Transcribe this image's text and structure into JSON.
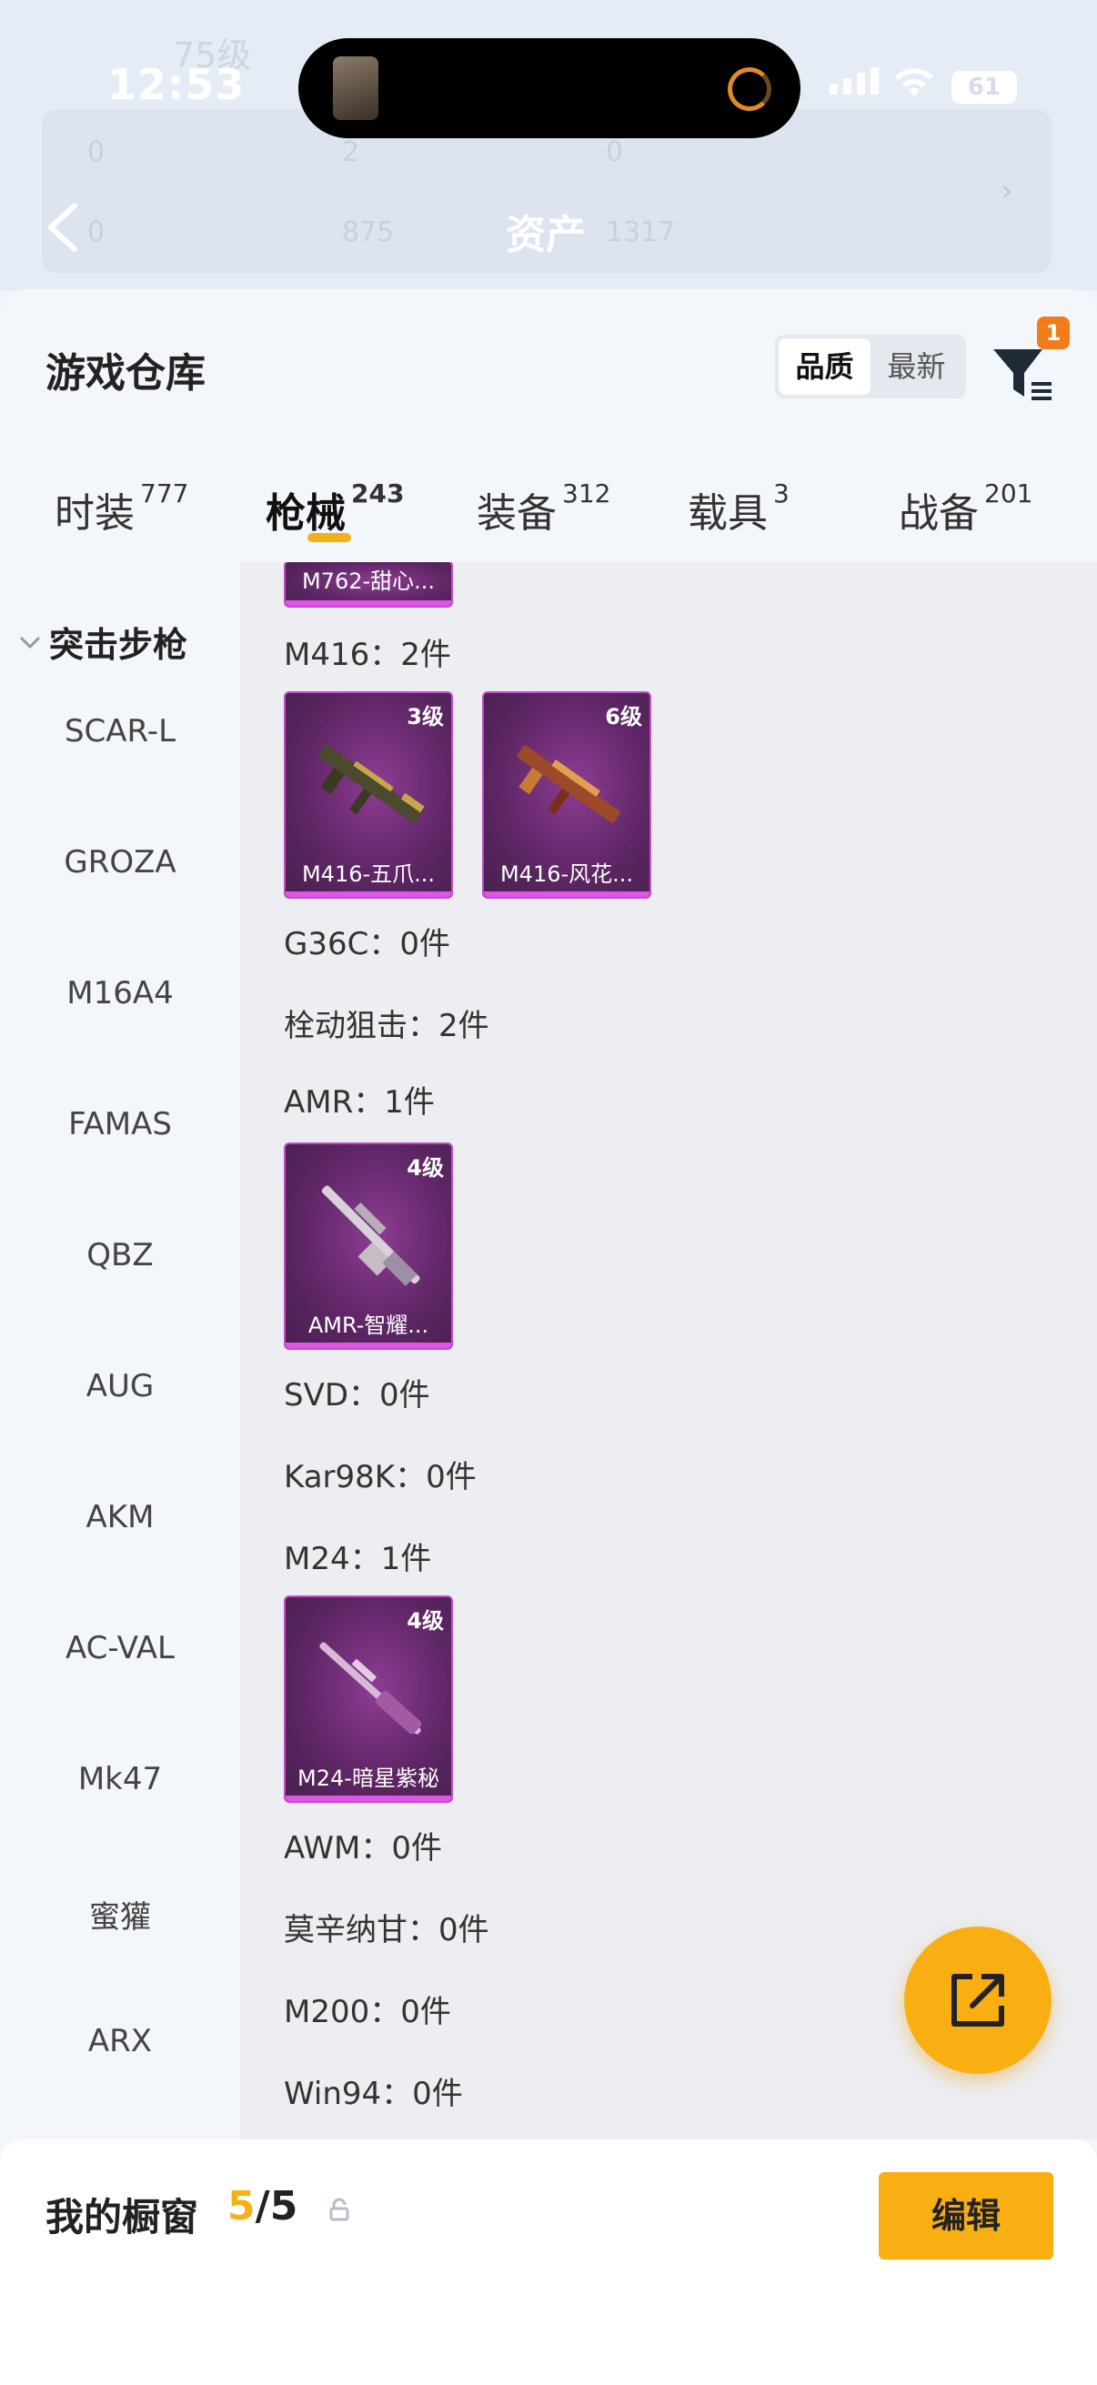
{
  "status_bar": {
    "time": "12:53",
    "battery": "61"
  },
  "background_header": {
    "level": "75级",
    "title": "资产",
    "stats_row1": [
      "0",
      "2",
      "0"
    ],
    "stats_row2": [
      "0",
      "875",
      "1317"
    ]
  },
  "warehouse": {
    "title": "游戏仓库",
    "sort_options": [
      "品质",
      "最新"
    ],
    "sort_selected": "品质",
    "filter_badge": "1"
  },
  "tabs": [
    {
      "label": "时装",
      "count": "777"
    },
    {
      "label": "枪械",
      "count": "243",
      "active": true
    },
    {
      "label": "装备",
      "count": "312"
    },
    {
      "label": "载具",
      "count": "3"
    },
    {
      "label": "战备",
      "count": "201"
    }
  ],
  "sidebar": {
    "group": "突击步枪",
    "items": [
      "SCAR-L",
      "GROZA",
      "M16A4",
      "FAMAS",
      "QBZ",
      "AUG",
      "AKM",
      "AC-VAL",
      "Mk47",
      "蜜獾",
      "ARX"
    ]
  },
  "content": {
    "partial_card": "M762-甜心...",
    "groups": [
      {
        "heading": "M416：2件",
        "cards": [
          {
            "level": "3级",
            "name": "M416-五爪..."
          },
          {
            "level": "6级",
            "name": "M416-风花..."
          }
        ]
      },
      {
        "heading": "G36C：0件",
        "cards": []
      },
      {
        "heading": "栓动狙击：2件",
        "cards": []
      },
      {
        "heading": "AMR：1件",
        "cards": [
          {
            "level": "4级",
            "name": "AMR-智耀..."
          }
        ]
      },
      {
        "heading": "SVD：0件",
        "cards": []
      },
      {
        "heading": "Kar98K：0件",
        "cards": []
      },
      {
        "heading": "M24：1件",
        "cards": [
          {
            "level": "4级",
            "name": "M24-暗星紫秘"
          }
        ]
      },
      {
        "heading": "AWM：0件",
        "cards": []
      },
      {
        "heading": "莫辛纳甘：0件",
        "cards": []
      },
      {
        "heading": "M200：0件",
        "cards": []
      },
      {
        "heading": "Win94：0件",
        "cards": []
      }
    ]
  },
  "bottom_bar": {
    "label": "我的橱窗",
    "current": "5",
    "total": "/5",
    "edit_label": "编辑"
  },
  "colors": {
    "accent": "#f9ae12",
    "card_purple": "#5c2563",
    "card_border": "#c24bc9",
    "badge": "#f07d1a"
  },
  "icons": [
    "back-arrow-icon",
    "filter-icon",
    "chevron-down-icon",
    "lock-icon",
    "share-icon",
    "wifi-icon",
    "signal-icon"
  ]
}
